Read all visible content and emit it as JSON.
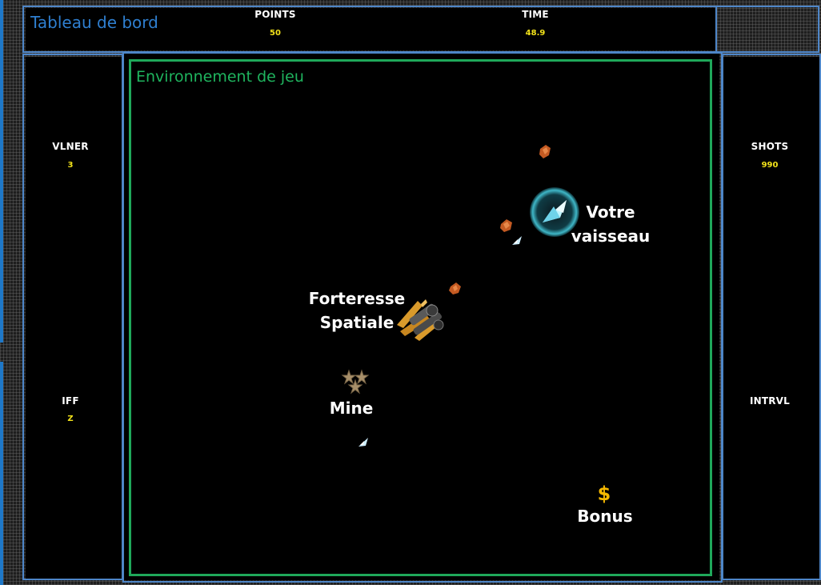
{
  "dashboard": {
    "title": "Tableau de bord",
    "points": {
      "label": "POINTS",
      "value": "50"
    },
    "time": {
      "label": "TIME",
      "value": "48.9"
    },
    "vlner": {
      "label": "VLNER",
      "value": "3"
    },
    "iff": {
      "label": "IFF",
      "value": "Z"
    },
    "shots": {
      "label": "SHOTS",
      "value": "990"
    },
    "intrvl": {
      "label": "INTRVL",
      "value": ""
    }
  },
  "game": {
    "title": "Environnement de jeu",
    "ship_label_1": "Votre",
    "ship_label_2": "vaisseau",
    "fortress_label_1": "Forteresse",
    "fortress_label_2": "Spatiale",
    "mine_label": "Mine",
    "bonus_symbol": "$",
    "bonus_label": "Bonus"
  },
  "colors": {
    "dashboard_frame": "#4e86c8",
    "game_frame": "#1fa85a",
    "stat_value": "#f2e21a",
    "bonus": "#f5b800"
  }
}
